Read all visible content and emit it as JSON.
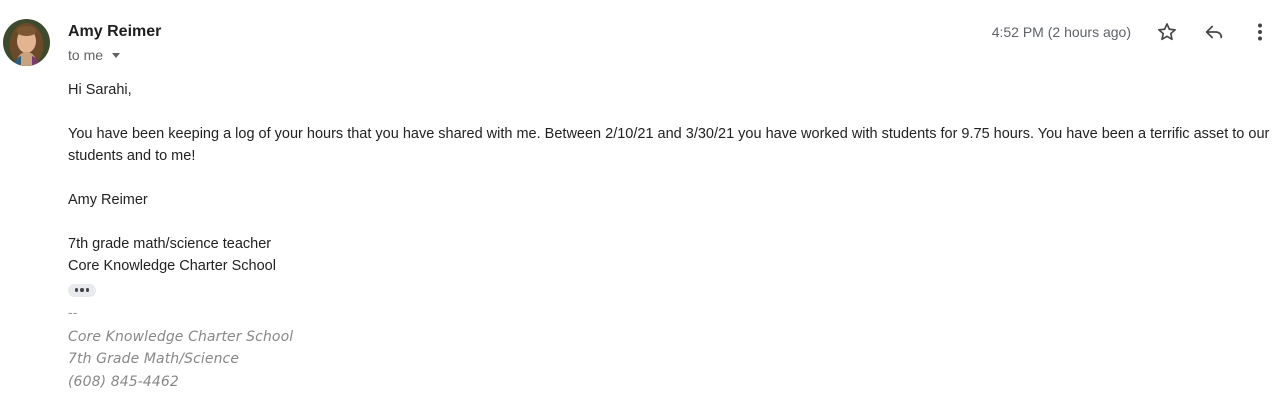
{
  "header": {
    "sender_name": "Amy Reimer",
    "recipient_label": "to me",
    "timestamp": "4:52 PM (2 hours ago)"
  },
  "icons": {
    "avatar": "avatar",
    "recipient_dropdown": "chevron-down-icon",
    "star": "star-icon",
    "reply": "reply-icon",
    "more": "more-vert-icon"
  },
  "body": {
    "greeting": "Hi Sarahi,",
    "paragraph": "You have been keeping a log of your hours that you have shared with me.  Between 2/10/21 and 3/30/21 you have worked with students for 9.75 hours.  You have been a terrific asset to our students and to me!",
    "sign_name": "Amy Reimer",
    "sign_title": "7th grade math/science teacher",
    "sign_school": "Core Knowledge Charter School"
  },
  "signature": {
    "separator": "--",
    "school": "Core Knowledge Charter School",
    "department": "7th Grade Math/Science",
    "phone": "(608) 845-4462"
  },
  "colors": {
    "text": "#222222",
    "muted": "#5f6368",
    "signature": "#888888",
    "chip": "#e8eaed"
  }
}
